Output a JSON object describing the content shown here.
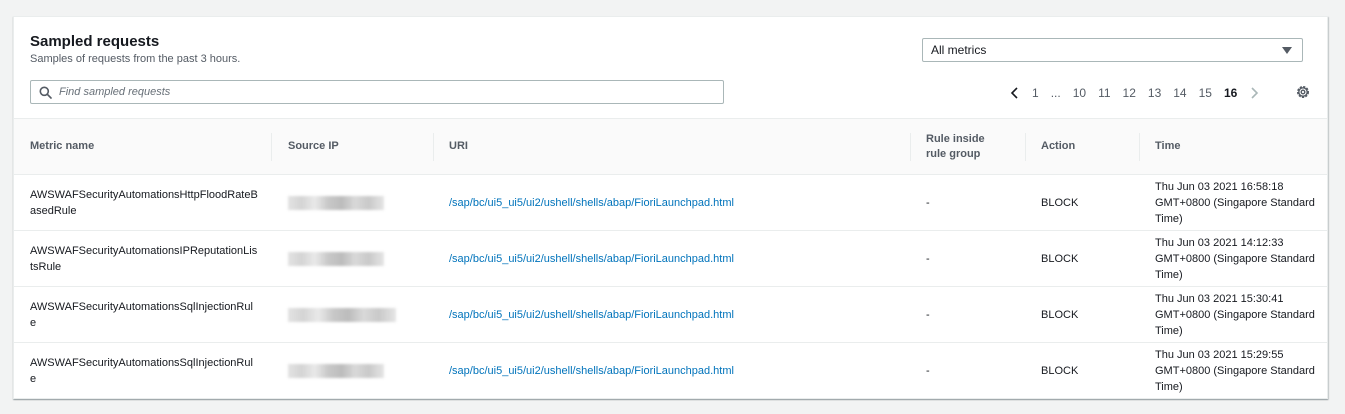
{
  "header": {
    "title": "Sampled requests",
    "subtitle": "Samples of requests from the past 3 hours."
  },
  "filter": {
    "selected": "All metrics"
  },
  "search": {
    "placeholder": "Find sampled requests"
  },
  "pagination": {
    "pages": [
      "1",
      "...",
      "10",
      "11",
      "12",
      "13",
      "14",
      "15",
      "16"
    ],
    "current": "16"
  },
  "table": {
    "columns": {
      "metric": "Metric name",
      "ip": "Source IP",
      "uri": "URI",
      "rule": "Rule inside rule group",
      "action": "Action",
      "time": "Time"
    },
    "rows": [
      {
        "metric": "AWSWAFSecurityAutomationsHttpFloodRateBasedRule",
        "uri": "/sap/bc/ui5_ui5/ui2/ushell/shells/abap/FioriLaunchpad.html",
        "rule": "-",
        "action": "BLOCK",
        "time": "Thu Jun 03 2021 16:58:18 GMT+0800 (Singapore Standard Time)"
      },
      {
        "metric": "AWSWAFSecurityAutomationsIPReputationListsRule",
        "uri": "/sap/bc/ui5_ui5/ui2/ushell/shells/abap/FioriLaunchpad.html",
        "rule": "-",
        "action": "BLOCK",
        "time": "Thu Jun 03 2021 14:12:33 GMT+0800 (Singapore Standard Time)"
      },
      {
        "metric": "AWSWAFSecurityAutomationsSqlInjectionRule",
        "uri": "/sap/bc/ui5_ui5/ui2/ushell/shells/abap/FioriLaunchpad.html",
        "rule": "-",
        "action": "BLOCK",
        "time": "Thu Jun 03 2021 15:30:41 GMT+0800 (Singapore Standard Time)"
      },
      {
        "metric": "AWSWAFSecurityAutomationsSqlInjectionRule",
        "uri": "/sap/bc/ui5_ui5/ui2/ushell/shells/abap/FioriLaunchpad.html",
        "rule": "-",
        "action": "BLOCK",
        "time": "Thu Jun 03 2021 15:29:55 GMT+0800 (Singapore Standard Time)"
      }
    ]
  },
  "icons": {
    "search": "search-icon",
    "prev": "chevron-left-icon",
    "next": "chevron-right-icon",
    "settings": "gear-icon",
    "dropdown": "caret-down-icon"
  },
  "colors": {
    "link": "#0073bb",
    "border": "#eaeded",
    "header_bg": "#fafafa",
    "page_bg": "#f2f3f3"
  }
}
